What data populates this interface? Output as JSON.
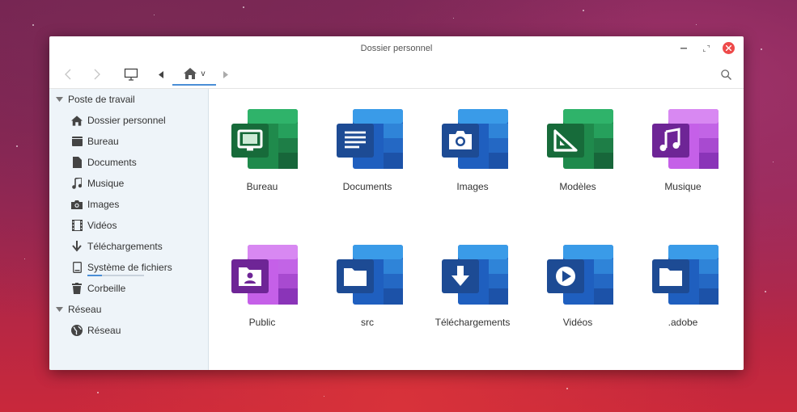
{
  "window": {
    "title": "Dossier personnel"
  },
  "toolbar": {
    "breadcrumb_label": "v"
  },
  "sidebar": {
    "sections": [
      {
        "label": "Poste de travail"
      },
      {
        "label": "Réseau"
      }
    ],
    "items": [
      {
        "label": "Dossier personnel",
        "icon": "home-icon"
      },
      {
        "label": "Bureau",
        "icon": "desktop-folder-icon"
      },
      {
        "label": "Documents",
        "icon": "document-icon"
      },
      {
        "label": "Musique",
        "icon": "music-icon"
      },
      {
        "label": "Images",
        "icon": "camera-icon"
      },
      {
        "label": "Vidéos",
        "icon": "film-icon"
      },
      {
        "label": "Téléchargements",
        "icon": "download-icon"
      },
      {
        "label": "Système de fichiers",
        "icon": "drive-icon",
        "usage": 0.25
      },
      {
        "label": "Corbeille",
        "icon": "trash-icon"
      },
      {
        "label": "Réseau",
        "icon": "globe-icon"
      }
    ]
  },
  "folders": [
    {
      "label": "Bureau",
      "icon": "monitor-icon",
      "color": "#1e7a44"
    },
    {
      "label": "Documents",
      "icon": "text-lines-icon",
      "color": "#2a5fa8"
    },
    {
      "label": "Images",
      "icon": "camera-icon",
      "color": "#2a5fa8"
    },
    {
      "label": "Modèles",
      "icon": "set-square-icon",
      "color": "#1e7a44"
    },
    {
      "label": "Musique",
      "icon": "music-note-icon",
      "color": "#8a2fb5"
    },
    {
      "label": "Public",
      "icon": "contact-card-icon",
      "color": "#8a2fb5"
    },
    {
      "label": "src",
      "icon": "folder-icon",
      "color": "#2a5fa8"
    },
    {
      "label": "Téléchargements",
      "icon": "download-arrow-icon",
      "color": "#2a5fa8"
    },
    {
      "label": "Vidéos",
      "icon": "play-icon",
      "color": "#2a5fa8"
    },
    {
      "label": ".adobe",
      "icon": "folder-icon",
      "color": "#2a5fa8"
    }
  ],
  "colors": {
    "accent": "#4a8ed6",
    "close": "#ee4a4a",
    "sidebar_bg": "#eef4f9"
  }
}
